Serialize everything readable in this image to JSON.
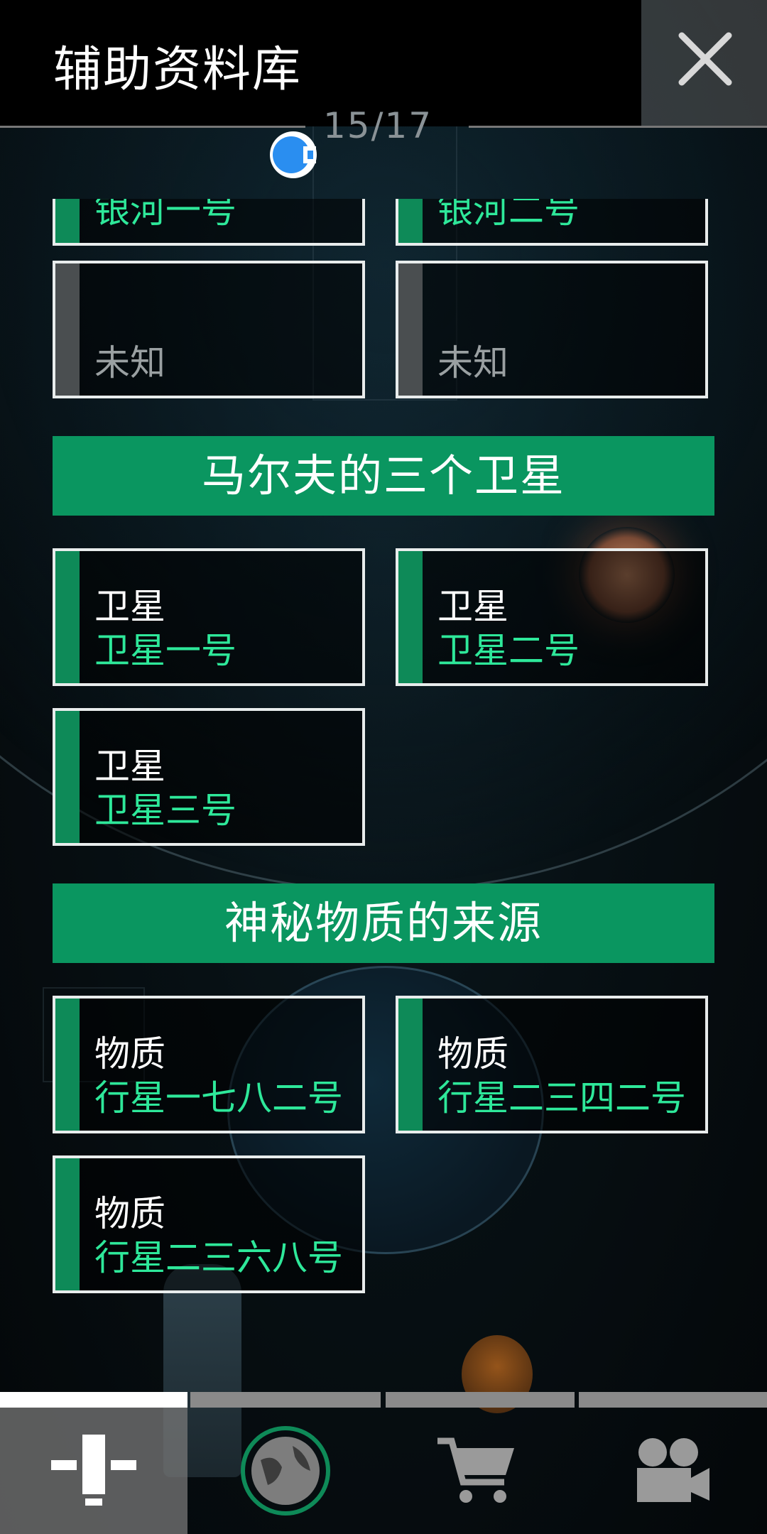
{
  "header": {
    "title": "辅助资料库",
    "progress": "15/17",
    "close_icon": "close-icon",
    "eye_icon": "camera-eye-icon"
  },
  "top_cards": [
    {
      "name": "银河一号"
    },
    {
      "name": "银河二号"
    },
    {
      "name": "未知",
      "locked": true
    },
    {
      "name": "未知",
      "locked": true
    }
  ],
  "sections": [
    {
      "title": "马尔夫的三个卫星",
      "cards": [
        {
          "category": "卫星",
          "name": "卫星一号"
        },
        {
          "category": "卫星",
          "name": "卫星二号"
        },
        {
          "category": "卫星",
          "name": "卫星三号"
        }
      ]
    },
    {
      "title": "神秘物质的来源",
      "cards": [
        {
          "category": "物质",
          "name": "行星一七八二号"
        },
        {
          "category": "物质",
          "name": "行星二三四二号"
        },
        {
          "category": "物质",
          "name": "行星二三六八号"
        }
      ]
    }
  ],
  "nav": {
    "tabs": [
      {
        "icon": "archive-icon",
        "active": true
      },
      {
        "icon": "planet-icon",
        "active": false
      },
      {
        "icon": "cart-icon",
        "active": false
      },
      {
        "icon": "video-camera-icon",
        "active": false
      }
    ]
  },
  "colors": {
    "accent_green": "#0a9660",
    "name_green": "#2ee89a",
    "card_border": "#e8ecec"
  }
}
